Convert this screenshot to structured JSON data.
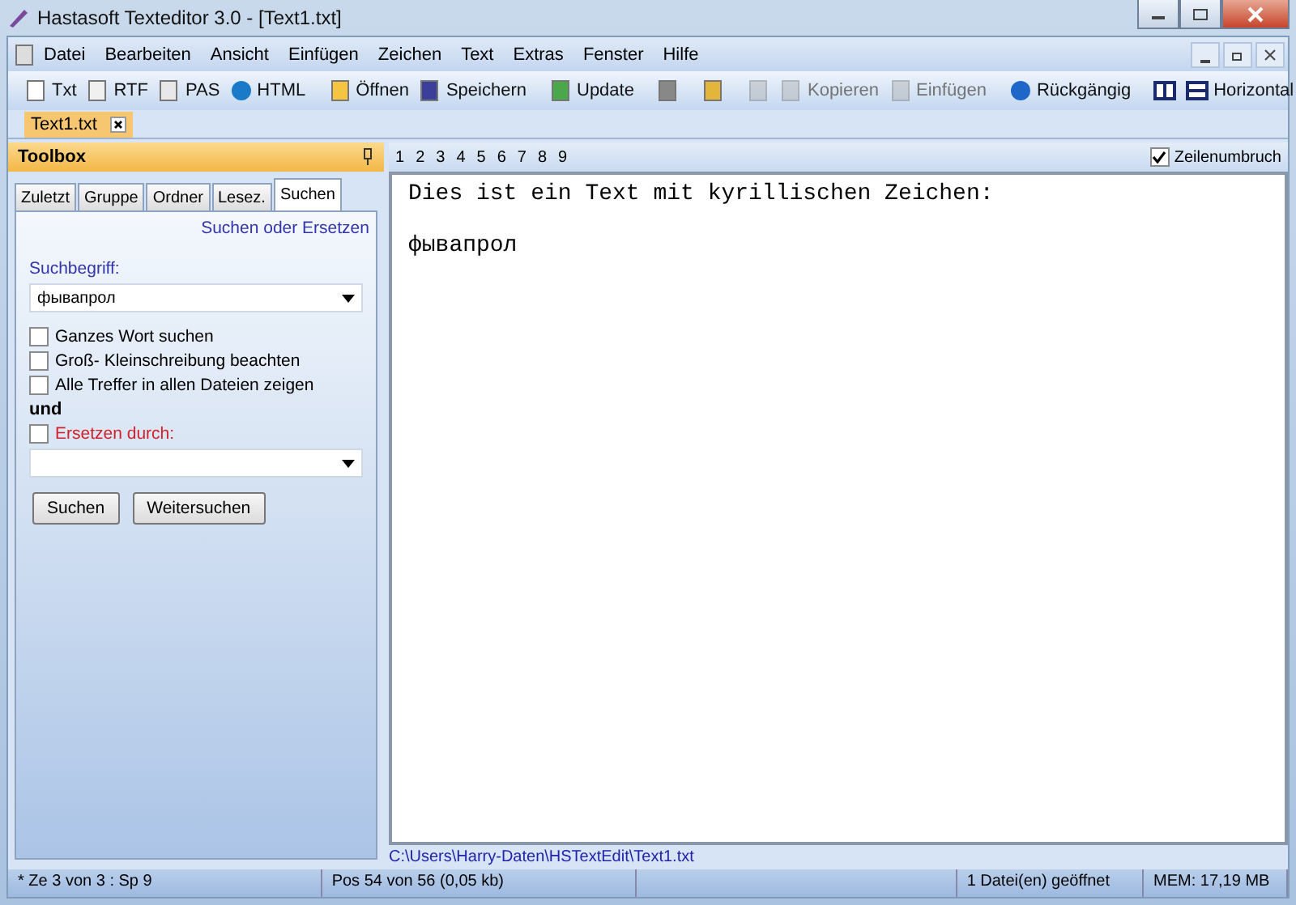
{
  "window": {
    "title": "Hastasoft Texteditor 3.0 - [Text1.txt]"
  },
  "menu": [
    "Datei",
    "Bearbeiten",
    "Ansicht",
    "Einfügen",
    "Zeichen",
    "Text",
    "Extras",
    "Fenster",
    "Hilfe"
  ],
  "toolbar": [
    {
      "kind": "button",
      "label": "Txt",
      "disabled": false
    },
    {
      "kind": "button",
      "label": "RTF",
      "disabled": false
    },
    {
      "kind": "button",
      "label": "PAS",
      "disabled": false
    },
    {
      "kind": "button",
      "label": "HTML",
      "disabled": false
    },
    {
      "kind": "separator"
    },
    {
      "kind": "button",
      "label": "Öffnen",
      "disabled": false
    },
    {
      "kind": "button",
      "label": "Speichern",
      "disabled": false
    },
    {
      "kind": "separator"
    },
    {
      "kind": "button",
      "label": "Update",
      "disabled": false
    },
    {
      "kind": "separator"
    },
    {
      "kind": "button",
      "disabled": false
    },
    {
      "kind": "separator"
    },
    {
      "kind": "button",
      "disabled": false
    },
    {
      "kind": "separator"
    },
    {
      "kind": "button",
      "disabled": true
    },
    {
      "kind": "button",
      "label": "Kopieren",
      "disabled": true
    },
    {
      "kind": "button",
      "label": "Einfügen",
      "disabled": true
    },
    {
      "kind": "separator"
    },
    {
      "kind": "button",
      "label": "Rückgängig",
      "disabled": false
    },
    {
      "kind": "separator"
    },
    {
      "kind": "button",
      "disabled": false
    },
    {
      "kind": "button",
      "label": "Horizontal",
      "disabled": false
    }
  ],
  "doc_tabs": [
    {
      "label": "Text1.txt",
      "selected": true
    }
  ],
  "toolbox": {
    "title": "Toolbox",
    "tabs": [
      {
        "label": "Zuletzt",
        "selected": false
      },
      {
        "label": "Gruppe",
        "selected": false
      },
      {
        "label": "Ordner",
        "selected": false
      },
      {
        "label": "Lesez.",
        "selected": false
      },
      {
        "label": "Suchen",
        "selected": true
      }
    ],
    "heading": "Suchen oder Ersetzen",
    "search_label": "Suchbegriff:",
    "search_value": "фывапрол",
    "options": [
      {
        "label": "Ganzes Wort suchen",
        "checked": false
      },
      {
        "label": "Groß- Kleinschreibung beachten",
        "checked": false
      },
      {
        "label": "Alle Treffer in allen  Dateien zeigen",
        "checked": false
      }
    ],
    "and_label": "und",
    "replace": {
      "label": "Ersetzen durch:",
      "checked": false
    },
    "buttons": [
      "Suchen",
      "Weitersuchen"
    ]
  },
  "editor": {
    "ruler": [
      "1",
      "2",
      "3",
      "4",
      "5",
      "6",
      "7",
      "8",
      "9"
    ],
    "wrap": {
      "label": "Zeilenumbruch",
      "checked": true
    },
    "paragraphs": [
      "Dies ist ein Text mit kyrillischen Zeichen:",
      "фывапрол"
    ],
    "path": "C:\\Users\\Harry-Daten\\HSTextEdit\\Text1.txt"
  },
  "status_bar": [
    "* Ze 3 von 3 : Sp 9",
    "Pos 54 von 56 (0,05 kb)",
    "1 Datei(en) geöffnet",
    "MEM:  17,19 MB"
  ]
}
